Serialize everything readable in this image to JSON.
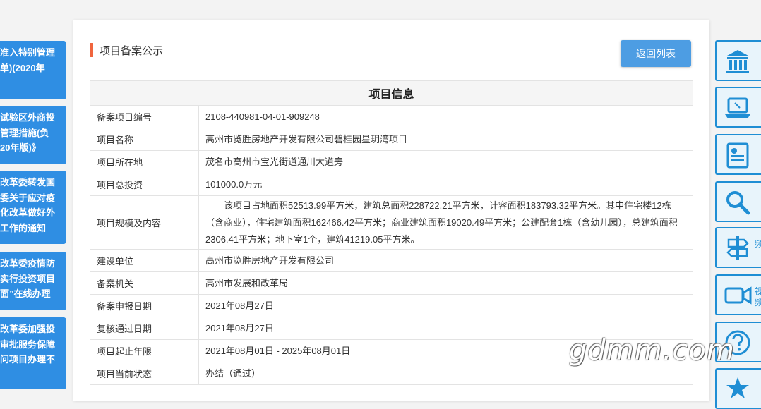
{
  "left_banners": [
    {
      "lines": [
        "准入特别管理",
        "单)(2020年"
      ]
    },
    {
      "lines": [
        "试验区外商投",
        "管理措施(负",
        "20年版)》"
      ]
    },
    {
      "lines": [
        "改革委转发国",
        "委关于应对疫",
        "化改革做好外",
        "工作的通知"
      ]
    },
    {
      "lines": [
        "改革委疫情防",
        "实行投资项目",
        "面”在线办理"
      ]
    },
    {
      "lines": [
        "改革委加强投",
        "审批服务保障",
        "问项目办理不"
      ]
    }
  ],
  "panel": {
    "title": "项目备案公示",
    "back_button": "返回列表",
    "table_header": "项目信息",
    "rows": [
      {
        "label": "备案项目编号",
        "value": "2108-440981-04-01-909248"
      },
      {
        "label": "项目名称",
        "value": "高州市览胜房地产开发有限公司碧桂园星玥湾项目"
      },
      {
        "label": "项目所在地",
        "value": "茂名市高州市宝光街道通川大道旁"
      },
      {
        "label": "项目总投资",
        "value": "101000.0万元"
      },
      {
        "label": "项目规模及内容",
        "value": "该项目占地面积52513.99平方米，建筑总面积228722.21平方米，计容面积183793.32平方米。其中住宅楼12栋（含商业），住宅建筑面积162466.42平方米；商业建筑面积19020.49平方米；公建配套1栋（含幼儿园），总建筑面积2306.41平方米；地下室1个，建筑41219.05平方米。"
      },
      {
        "label": "建设单位",
        "value": "高州市览胜房地产开发有限公司"
      },
      {
        "label": "备案机关",
        "value": "高州市发展和改革局"
      },
      {
        "label": "备案申报日期",
        "value": "2021年08月27日"
      },
      {
        "label": "复核通过日期",
        "value": "2021年08月27日"
      },
      {
        "label": "项目起止年限",
        "value": "2021年08月01日 - 2025年08月01日"
      },
      {
        "label": "项目当前状态",
        "value": "办结（通过）"
      }
    ]
  },
  "right_sidebar": {
    "items": [
      {
        "icon": "building-icon",
        "side_text": ""
      },
      {
        "icon": "laptop-icon",
        "side_text": ""
      },
      {
        "icon": "document-icon",
        "side_text": ""
      },
      {
        "icon": "search-icon",
        "side_text": ""
      },
      {
        "icon": "signpost-icon",
        "side_text": "频"
      },
      {
        "icon": "video-camera-icon",
        "side_text": "视频"
      },
      {
        "icon": "question-icon",
        "side_text": ""
      },
      {
        "icon": "star-badge-icon",
        "side_text": ""
      }
    ]
  },
  "watermark": "gdmm.com",
  "colors": {
    "primary": "#2f8ee3",
    "accent": "#f0653e",
    "button": "#4d9de3"
  }
}
